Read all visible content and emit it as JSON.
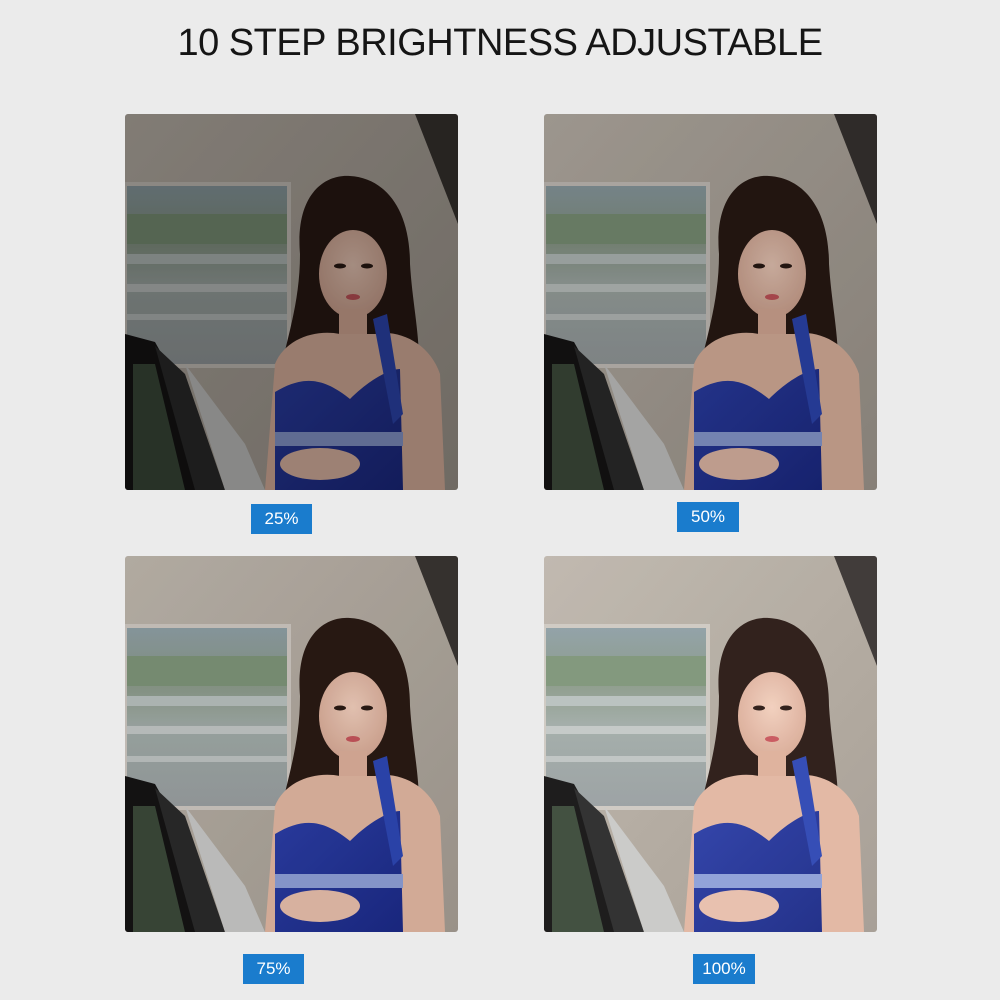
{
  "title": "10 STEP BRIGHTNESS ADJUSTABLE",
  "accent_color": "#1a7ccd",
  "panels": [
    {
      "label": "25%",
      "brightness": 0.25
    },
    {
      "label": "50%",
      "brightness": 0.5
    },
    {
      "label": "75%",
      "brightness": 0.75
    },
    {
      "label": "100%",
      "brightness": 1.0
    }
  ]
}
